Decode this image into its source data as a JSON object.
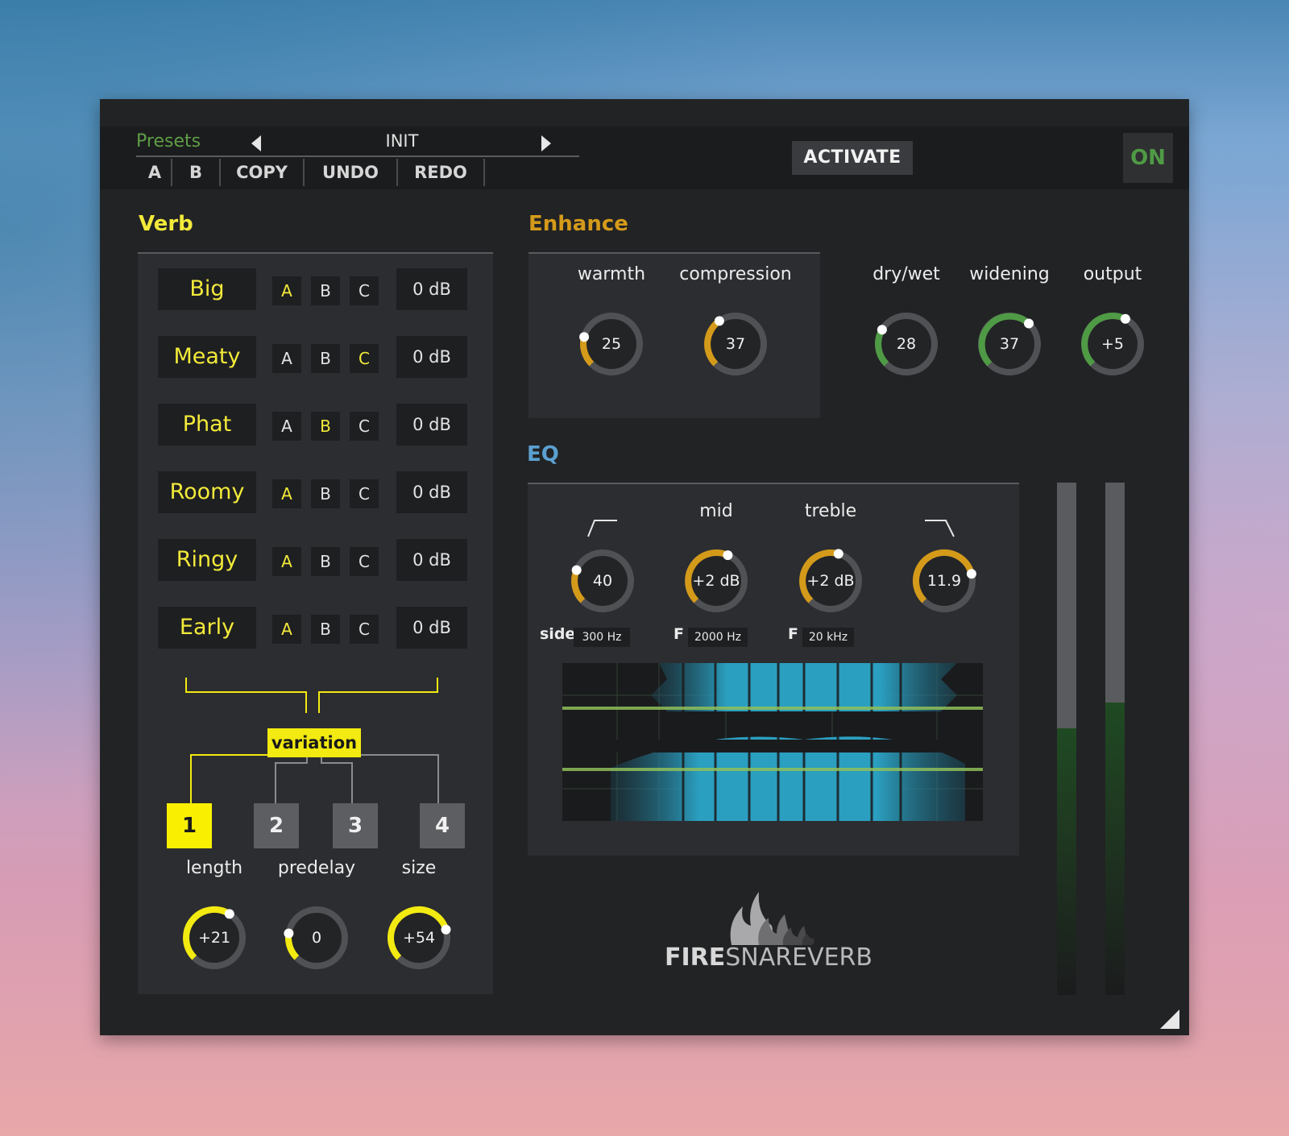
{
  "presets": {
    "label": "Presets",
    "current": "INIT",
    "buttons": [
      "A",
      "B",
      "COPY",
      "UNDO",
      "REDO"
    ]
  },
  "activate_label": "ACTIVATE",
  "power_label": "ON",
  "verb": {
    "title": "Verb",
    "rows": [
      {
        "name": "Big",
        "selected": "A",
        "gain": "0 dB"
      },
      {
        "name": "Meaty",
        "selected": "C",
        "gain": "0 dB"
      },
      {
        "name": "Phat",
        "selected": "B",
        "gain": "0 dB"
      },
      {
        "name": "Roomy",
        "selected": "A",
        "gain": "0 dB"
      },
      {
        "name": "Ringy",
        "selected": "A",
        "gain": "0 dB"
      },
      {
        "name": "Early",
        "selected": "A",
        "gain": "0 dB"
      }
    ],
    "abc": [
      "A",
      "B",
      "C"
    ],
    "variation_label": "variation",
    "variations": [
      "1",
      "2",
      "3",
      "4"
    ],
    "selected_variation": "1",
    "knobs": [
      {
        "label": "length",
        "value": "+21",
        "level": 0.62
      },
      {
        "label": "predelay",
        "value": "0",
        "level": 0.2
      },
      {
        "label": "size",
        "value": "+54",
        "level": 0.77
      }
    ]
  },
  "enhance": {
    "title": "Enhance",
    "knobs": [
      {
        "label": "warmth",
        "value": "25",
        "level": 0.22
      },
      {
        "label": "compression",
        "value": "37",
        "level": 0.37
      }
    ]
  },
  "master": {
    "knobs": [
      {
        "label": "dry/wet",
        "value": "28",
        "level": 0.28
      },
      {
        "label": "widening",
        "value": "37",
        "level": 0.66
      },
      {
        "label": "output",
        "value": "+5",
        "level": 0.6
      }
    ]
  },
  "eq": {
    "title": "EQ",
    "knobs": [
      {
        "label": "",
        "icon": "highpass-icon",
        "value": "40",
        "level": 0.25
      },
      {
        "label": "mid",
        "value": "+2 dB",
        "level": 0.59
      },
      {
        "label": "treble",
        "value": "+2 dB",
        "level": 0.56
      },
      {
        "label": "",
        "icon": "lowpass-icon",
        "value": "11.9",
        "level": 0.78
      }
    ],
    "fields": [
      {
        "prefix": "side",
        "value": "300 Hz"
      },
      {
        "prefix": "F",
        "value": "2000 Hz"
      },
      {
        "prefix": "F",
        "value": "20 kHz"
      }
    ]
  },
  "meters": [
    0.52,
    0.57
  ],
  "logo": {
    "bold": "FIRE",
    "rest": "SNAREVERB"
  },
  "colors": {
    "accent_yellow": "#f2ea10",
    "enhance_gold": "#d49a1a",
    "master_green": "#4f9a45",
    "eq_blue": "#5aa0d0",
    "presets_green": "#5e9e45"
  }
}
